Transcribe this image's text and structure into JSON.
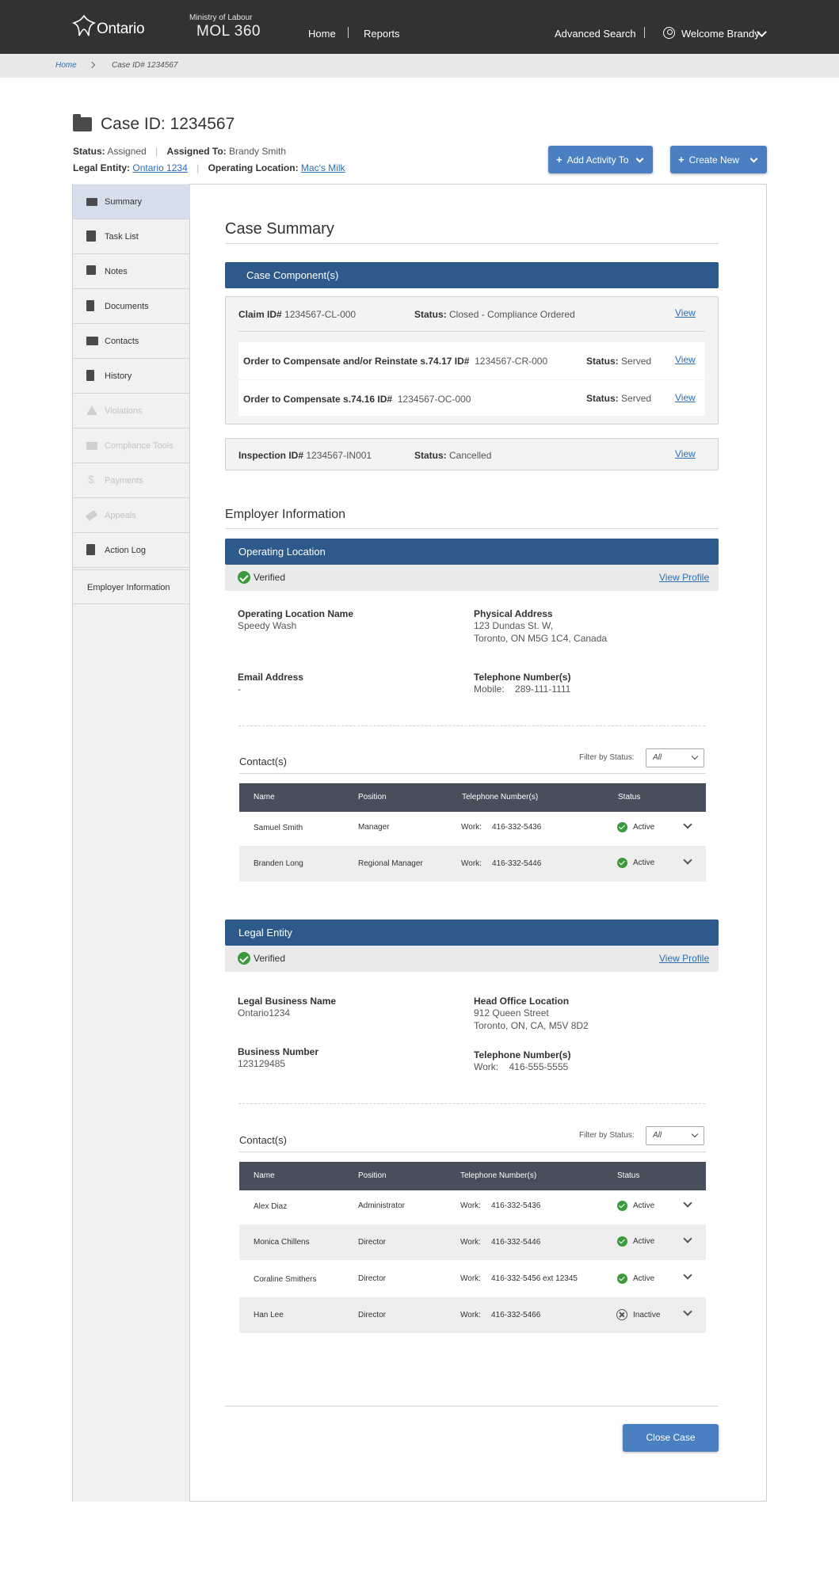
{
  "header": {
    "logo_text": "Ontario",
    "ministry": "Ministry of Labour",
    "app_name": "MOL 360",
    "nav": {
      "home": "Home",
      "reports": "Reports"
    },
    "advanced_search": "Advanced Search",
    "welcome": "Welcome Brandy"
  },
  "breadcrumb": {
    "home": "Home",
    "current": "Case ID# 1234567"
  },
  "case": {
    "title": "Case ID: 1234567",
    "status_label": "Status:",
    "status_value": "Assigned",
    "assigned_label": "Assigned To:",
    "assigned_value": "Brandy Smith",
    "legal_entity_label": "Legal Entity:",
    "legal_entity_value": "Ontario 1234",
    "operating_location_label": "Operating Location:",
    "operating_location_value": "Mac's Milk"
  },
  "actions": {
    "add_activity": "Add Activity To",
    "create_new": "Create New",
    "close_case": "Close Case"
  },
  "sidebar": {
    "items": [
      {
        "label": "Summary",
        "icon": "folder-open-icon",
        "state": "active"
      },
      {
        "label": "Task List",
        "icon": "clipboard-icon",
        "state": "enabled"
      },
      {
        "label": "Notes",
        "icon": "note-icon",
        "state": "enabled"
      },
      {
        "label": "Documents",
        "icon": "document-icon",
        "state": "enabled"
      },
      {
        "label": "Contacts",
        "icon": "contact-card-icon",
        "state": "enabled"
      },
      {
        "label": "History",
        "icon": "bookmark-icon",
        "state": "enabled"
      },
      {
        "label": "Violations",
        "icon": "warning-icon",
        "state": "disabled"
      },
      {
        "label": "Compliance Tools",
        "icon": "toolbox-icon",
        "state": "disabled"
      },
      {
        "label": "Payments",
        "icon": "dollar-icon",
        "state": "disabled"
      },
      {
        "label": "Appeals",
        "icon": "gavel-icon",
        "state": "disabled"
      },
      {
        "label": "Action Log",
        "icon": "log-book-icon",
        "state": "enabled"
      },
      {
        "label": "Employer Information",
        "icon": "",
        "state": "enabled"
      }
    ]
  },
  "summary": {
    "title": "Case Summary",
    "components_header": "Case Component(s)",
    "claim": {
      "id_label": "Claim ID#",
      "id": "1234567-CL-000",
      "status_label": "Status:",
      "status": "Closed - Compliance Ordered",
      "view": "View"
    },
    "orders": [
      {
        "label": "Order to Compensate and/or Reinstate s.74.17 ID#",
        "id": "1234567-CR-000",
        "status_label": "Status:",
        "status": "Served",
        "view": "View"
      },
      {
        "label": "Order to Compensate s.74.16 ID#",
        "id": "1234567-OC-000",
        "status_label": "Status:",
        "status": "Served",
        "view": "View"
      }
    ],
    "inspection": {
      "id_label": "Inspection ID#",
      "id": "1234567-IN001",
      "status_label": "Status:",
      "status": "Cancelled",
      "view": "View"
    }
  },
  "employer": {
    "title": "Employer Information",
    "operating_location": {
      "header": "Operating Location",
      "verified": "Verified",
      "view_profile": "View Profile",
      "name_label": "Operating Location Name",
      "name": "Speedy Wash",
      "address_label": "Physical Address",
      "address_line1": "123 Dundas St. W,",
      "address_line2": "Toronto, ON M5G 1C4, Canada",
      "email_label": "Email Address",
      "email": "-",
      "phone_label": "Telephone Number(s)",
      "phone_type": "Mobile:",
      "phone": "289-111-1111",
      "contacts_title": "Contact(s)",
      "filter_label": "Filter by Status:",
      "filter_value": "All",
      "columns": [
        "Name",
        "Position",
        "Telephone Number(s)",
        "Status"
      ],
      "rows": [
        {
          "name": "Samuel Smith",
          "position": "Manager",
          "phone_type": "Work:",
          "phone": "416-332-5436",
          "status": "Active"
        },
        {
          "name": "Branden Long",
          "position": "Regional Manager",
          "phone_type": "Work:",
          "phone": "416-332-5446",
          "status": "Active"
        }
      ]
    },
    "legal_entity": {
      "header": "Legal Entity",
      "verified": "Verified",
      "view_profile": "View Profile",
      "name_label": "Legal Business Name",
      "name": "Ontario1234",
      "hq_label": "Head Office Location",
      "hq_line1": "912 Queen Street",
      "hq_line2": "Toronto, ON, CA, M5V 8D2",
      "bn_label": "Business Number",
      "bn": "123129485",
      "phone_label": "Telephone Number(s)",
      "phone_type": "Work:",
      "phone": "416-555-5555",
      "contacts_title": "Contact(s)",
      "filter_label": "Filter by Status:",
      "filter_value": "All",
      "columns": [
        "Name",
        "Position",
        "Telephone Number(s)",
        "Status"
      ],
      "rows": [
        {
          "name": "Alex Diaz",
          "position": "Administrator",
          "phone_type": "Work:",
          "phone": "416-332-5436",
          "status": "Active"
        },
        {
          "name": "Monica Chillens",
          "position": "Director",
          "phone_type": "Work:",
          "phone": "416-332-5446",
          "status": "Active"
        },
        {
          "name": "Coraline Smithers",
          "position": "Director",
          "phone_type": "Work:",
          "phone": "416-332-5456 ext 12345",
          "status": "Active"
        },
        {
          "name": "Han Lee",
          "position": "Director",
          "phone_type": "Work:",
          "phone": "416-332-5466",
          "status": "Inactive"
        }
      ]
    }
  }
}
